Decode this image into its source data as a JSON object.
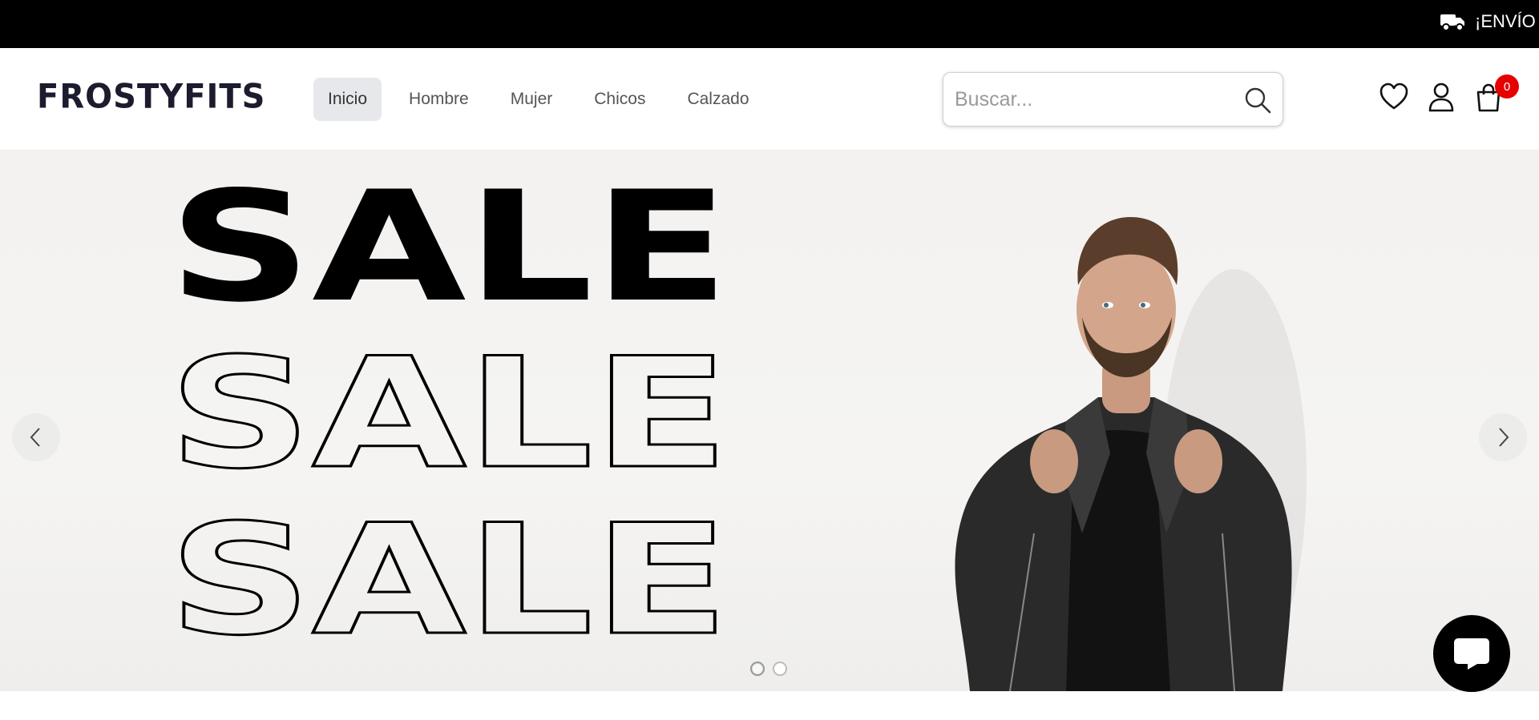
{
  "announcement": {
    "text": "¡ENVÍO G",
    "icon": "truck-icon"
  },
  "header": {
    "logo": "FROSTYFITS",
    "nav": [
      {
        "label": "Inicio",
        "active": true
      },
      {
        "label": "Hombre",
        "active": false
      },
      {
        "label": "Mujer",
        "active": false
      },
      {
        "label": "Chicos",
        "active": false
      },
      {
        "label": "Calzado",
        "active": false
      }
    ],
    "search": {
      "placeholder": "Buscar...",
      "value": "",
      "icon": "search-icon"
    },
    "icons": [
      "heart-icon",
      "user-icon",
      "shopping-bag-icon"
    ],
    "cart_count": "0"
  },
  "hero": {
    "lines": [
      "SALE",
      "SALE",
      "SALE"
    ],
    "image": "man-in-leather-jacket-photo",
    "slide_count": 2,
    "active_slide": 1
  },
  "chat": {
    "icon": "chat-bubble-icon"
  },
  "colors": {
    "announcement_bg": "#000000",
    "badge": "#e60000",
    "nav_active_bg": "#e6e8eb",
    "hero_bg": "#f3f2f0"
  }
}
